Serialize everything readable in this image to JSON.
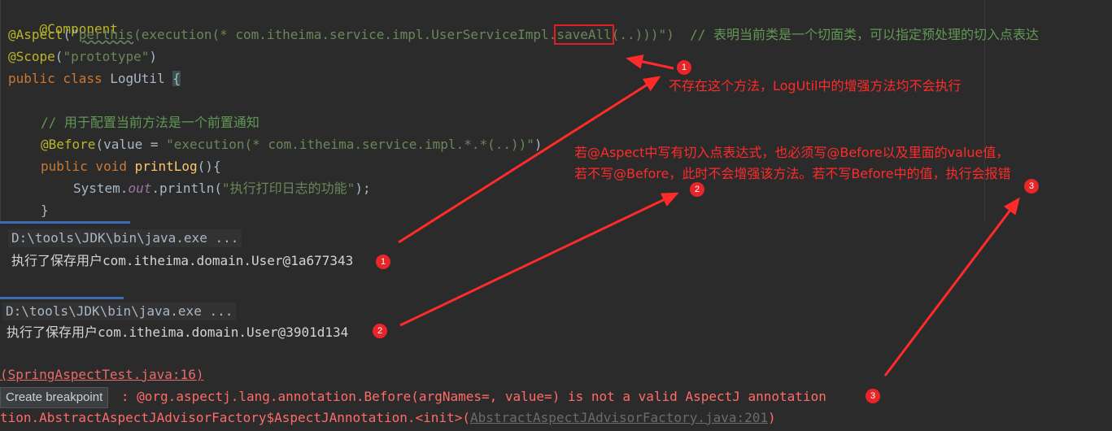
{
  "editor": {
    "line1": {
      "annotation": "@Component"
    },
    "line2": {
      "annotation": "@Aspect",
      "open": "(\"",
      "perthis": "perthis",
      "exec_prefix": "(execution(* com.itheima.service.impl.UserServiceImpl.",
      "method": "saveAll",
      "exec_suffix": "(..)))\")",
      "comment": "// 表明当前类是一个切面类，可以指定预处理的切入点表达"
    },
    "line3": {
      "annotation": "@Scope",
      "open": "(",
      "value": "\"prototype\"",
      "close": ")"
    },
    "line4": {
      "kw": "public class",
      "name": " LogUtil ",
      "brace": "{"
    },
    "line6": {
      "comment": "// 用于配置当前方法是一个前置通知"
    },
    "line7": {
      "annotation": "@Before",
      "p1": "(value = ",
      "value": "\"execution(* com.itheima.service.impl.*.*(..))\"",
      "p2": ")"
    },
    "line8": {
      "kw": "public void",
      "fn": " printLog",
      "rest": "(){"
    },
    "line9": {
      "cls": "System.",
      "field": "out",
      "call": ".println(",
      "str": "\"执行打印日志的功能\"",
      "end": ");"
    },
    "line10": {
      "brace": "}"
    }
  },
  "console1": {
    "path": "D:\\tools\\JDK\\bin\\java.exe ...",
    "output": "执行了保存用户com.itheima.domain.User@1a677343"
  },
  "console2": {
    "path": "D:\\tools\\JDK\\bin\\java.exe ...",
    "output": "执行了保存用户com.itheima.domain.User@3901d134"
  },
  "errors": {
    "loc_link": "(SpringAspectTest.java:16)",
    "breakpoint_label": "Create breakpoint",
    "message": " : @org.aspectj.lang.annotation.Before(argNames=, value=) is not a valid AspectJ annotation",
    "trace_prefix": "tion.AbstractAspectJAdvisorFactory$AspectJAnnotation.<init>(",
    "trace_link": "AbstractAspectJAdvisorFactory.java:201",
    "trace_end": ")"
  },
  "annotations": {
    "note1": "不存在这个方法，LogUtil中的增强方法均不会执行",
    "note2_line1": "若@Aspect中写有切入点表达式，也必须写@Before以及里面的value值，",
    "note2_line2": "若不写@Before，此时不会增强该方法。若不写Before中的值，执行会报错",
    "badges": [
      "1",
      "2",
      "3"
    ]
  },
  "colors": {
    "arrow": "#ff2b2b",
    "badge": "#e8262a",
    "background": "#2b2b2b"
  }
}
